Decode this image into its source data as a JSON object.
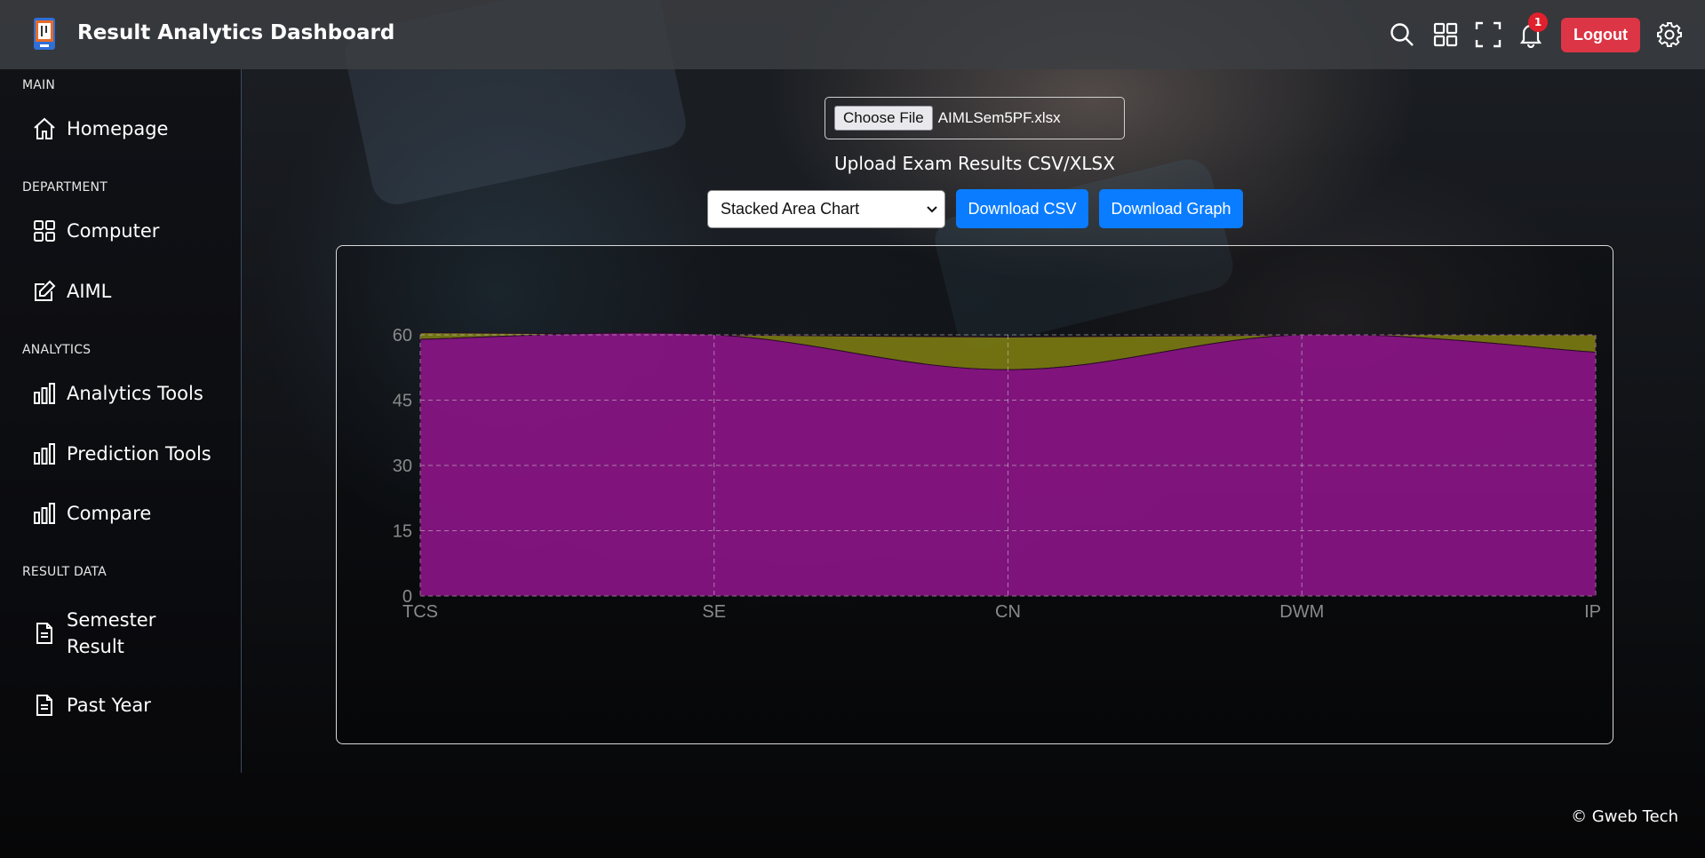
{
  "app": {
    "title": "Result Analytics Dashboard"
  },
  "header": {
    "notification_count": "1",
    "logout_label": "Logout",
    "icons": [
      "search-icon",
      "apps-grid-icon",
      "fullscreen-icon",
      "bell-icon",
      "gear-icon"
    ]
  },
  "sidebar": {
    "sections": [
      {
        "label": "MAIN",
        "items": [
          {
            "label": "Homepage",
            "icon": "home-icon"
          }
        ]
      },
      {
        "label": "DEPARTMENT",
        "items": [
          {
            "label": "Computer",
            "icon": "grid-icon"
          },
          {
            "label": "AIML",
            "icon": "edit-icon"
          }
        ]
      },
      {
        "label": "ANALYTICS",
        "items": [
          {
            "label": "Analytics Tools",
            "icon": "bar-chart-icon"
          },
          {
            "label": "Prediction Tools",
            "icon": "bar-chart-icon"
          },
          {
            "label": "Compare",
            "icon": "bar-chart-icon"
          }
        ]
      },
      {
        "label": "RESULT DATA",
        "items": [
          {
            "label": "Semester",
            "label_line2": "Result",
            "icon": "document-icon"
          },
          {
            "label": "Past Year",
            "icon": "document-icon"
          }
        ]
      }
    ]
  },
  "upload": {
    "choose_file_label": "Choose File",
    "file_name": "AIMLSem5PF.xlsx",
    "caption": "Upload Exam Results CSV/XLSX"
  },
  "controls": {
    "chart_type_selected": "Stacked Area Chart",
    "download_csv_label": "Download CSV",
    "download_graph_label": "Download Graph"
  },
  "chart_data": {
    "type": "area",
    "stacked": true,
    "categories": [
      "TCS",
      "SE",
      "CN",
      "DWM",
      "IP"
    ],
    "ylim": [
      0,
      60
    ],
    "yticks": [
      0,
      15,
      30,
      45,
      60
    ],
    "grid": true,
    "series": [
      {
        "values": [
          59,
          60,
          52,
          60,
          56
        ],
        "color": "#8a1585"
      },
      {
        "values": [
          1.5,
          0,
          7.5,
          0,
          4
        ],
        "color": "#7a7a12"
      }
    ]
  },
  "footer": {
    "text": "© Gweb Tech"
  }
}
